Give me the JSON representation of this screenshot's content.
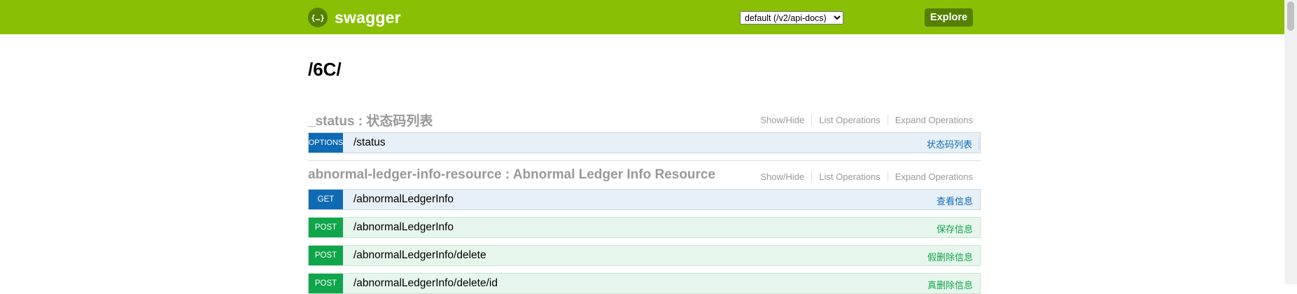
{
  "header": {
    "logo_icon": "{…}",
    "logo_text": "swagger",
    "api_select_value": "default (/v2/api-docs)",
    "explore_label": "Explore",
    "bg_color": "#89bf04"
  },
  "page_title": "/6C/",
  "resource_ops": {
    "show_hide": "Show/Hide",
    "list_operations": "List Operations",
    "expand_operations": "Expand Operations"
  },
  "resources": [
    {
      "name": "_status",
      "separator": " : ",
      "description": "状态码列表",
      "operations": [
        {
          "method": "OPTIONS",
          "path": "/status",
          "summary": "状态码列表"
        }
      ]
    },
    {
      "name": "abnormal-ledger-info-resource",
      "separator": " : ",
      "description": "Abnormal Ledger Info Resource",
      "operations": [
        {
          "method": "GET",
          "path": "/abnormalLedgerInfo",
          "summary": "查看信息"
        },
        {
          "method": "POST",
          "path": "/abnormalLedgerInfo",
          "summary": "保存信息"
        },
        {
          "method": "POST",
          "path": "/abnormalLedgerInfo/delete",
          "summary": "假删除信息"
        },
        {
          "method": "POST",
          "path": "/abnormalLedgerInfo/delete/id",
          "summary": "真删除信息"
        }
      ]
    }
  ],
  "colors": {
    "get": "#0f6ab4",
    "post": "#10a54a",
    "options": "#0f6ab4"
  }
}
